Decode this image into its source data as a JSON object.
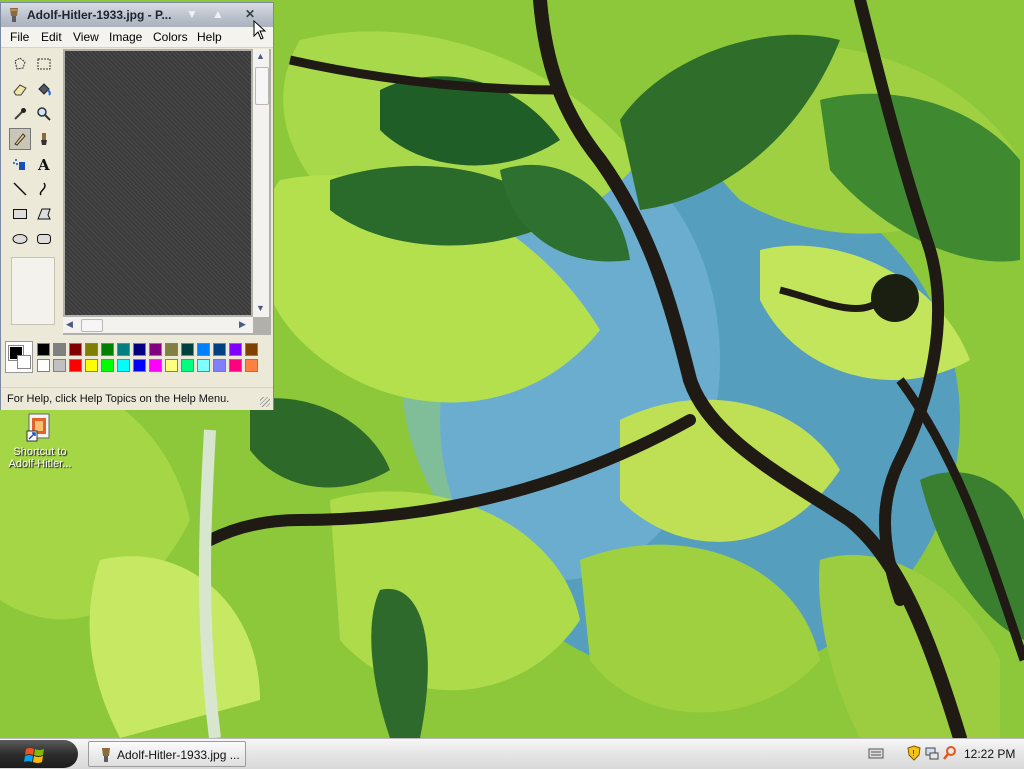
{
  "window": {
    "title": "Adolf-Hitler-1933.jpg - P...",
    "menu": [
      "File",
      "Edit",
      "View",
      "Image",
      "Colors",
      "Help"
    ],
    "status_text": "For Help, click Help Topics on the Help Menu."
  },
  "tools": [
    {
      "name": "free-form-select-icon"
    },
    {
      "name": "rect-select-icon"
    },
    {
      "name": "eraser-icon"
    },
    {
      "name": "fill-icon"
    },
    {
      "name": "pick-color-icon"
    },
    {
      "name": "magnifier-icon"
    },
    {
      "name": "pencil-icon",
      "selected": true
    },
    {
      "name": "brush-icon"
    },
    {
      "name": "airbrush-icon"
    },
    {
      "name": "text-icon"
    },
    {
      "name": "line-icon"
    },
    {
      "name": "curve-icon"
    },
    {
      "name": "rectangle-icon"
    },
    {
      "name": "polygon-icon"
    },
    {
      "name": "ellipse-icon"
    },
    {
      "name": "rounded-rect-icon"
    }
  ],
  "palette": {
    "foreground": "#000000",
    "background": "#ffffff",
    "row1": [
      "#000000",
      "#808080",
      "#800000",
      "#808000",
      "#008000",
      "#008080",
      "#000080",
      "#800080",
      "#808040",
      "#004040",
      "#0080ff",
      "#004080",
      "#8000ff",
      "#804000"
    ],
    "row2": [
      "#ffffff",
      "#c0c0c0",
      "#ff0000",
      "#ffff00",
      "#00ff00",
      "#00ffff",
      "#0000ff",
      "#ff00ff",
      "#ffff80",
      "#00ff80",
      "#80ffff",
      "#8080ff",
      "#ff0080",
      "#ff8040"
    ]
  },
  "desktop": {
    "icon_label": "Shortcut to Adolf-Hitler..."
  },
  "taskbar": {
    "task_label": "Adolf-Hitler-1933.jpg ...",
    "clock": "12:22 PM"
  }
}
